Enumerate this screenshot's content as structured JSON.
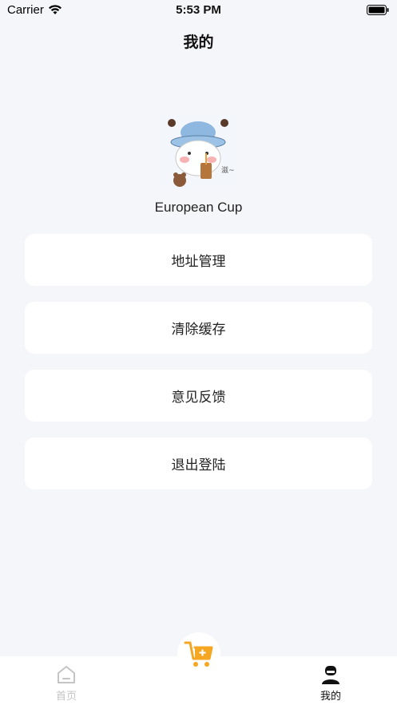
{
  "status_bar": {
    "carrier": "Carrier",
    "time": "5:53 PM",
    "wifi_icon": "wifi-icon",
    "battery_icon": "battery-icon"
  },
  "nav": {
    "title": "我的"
  },
  "profile": {
    "avatar_icon": "cartoon-bear-avatar",
    "username": "European Cup"
  },
  "menu": {
    "items": [
      {
        "label": "地址管理"
      },
      {
        "label": "清除缓存"
      },
      {
        "label": "意见反馈"
      },
      {
        "label": "退出登陆"
      }
    ]
  },
  "tab_bar": {
    "tabs": [
      {
        "label": "首页",
        "icon": "home-icon",
        "active": false
      },
      {
        "label": "我的",
        "icon": "user-icon",
        "active": true
      }
    ],
    "center_icon": "cart-add-icon",
    "accent_color": "#f5a623"
  }
}
